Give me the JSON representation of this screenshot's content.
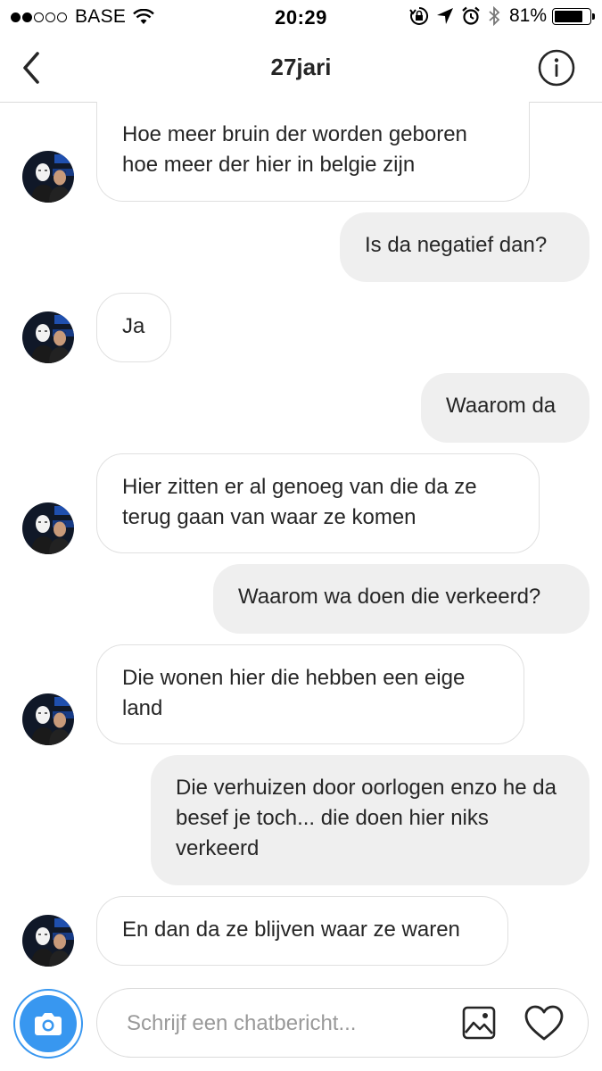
{
  "status_bar": {
    "carrier": "BASE",
    "time": "20:29",
    "battery_percent": "81%",
    "battery_level": 0.81,
    "signal_bars_filled": 2,
    "signal_bars_total": 5,
    "icons": [
      "wifi-icon",
      "rotation-lock-icon",
      "location-arrow-icon",
      "alarm-icon",
      "bluetooth-icon",
      "battery-icon"
    ]
  },
  "nav": {
    "title": "27jari",
    "back_icon": "chevron-left-icon",
    "info_icon": "info-icon"
  },
  "messages": [
    {
      "direction": "in",
      "text": "Hoe meer bruin der worden geboren hoe meer der hier in belgie zijn"
    },
    {
      "direction": "out",
      "text": "Is da negatief dan?"
    },
    {
      "direction": "in",
      "text": "Ja"
    },
    {
      "direction": "out",
      "text": "Waarom da"
    },
    {
      "direction": "in",
      "text": "Hier zitten er al genoeg van die da ze terug gaan van waar ze komen"
    },
    {
      "direction": "out",
      "text": "Waarom wa doen die verkeerd?"
    },
    {
      "direction": "in",
      "text": "Die wonen hier die hebben een eige land"
    },
    {
      "direction": "out",
      "text": "Die verhuizen door oorlogen enzo he da besef je toch... die doen hier niks verkeerd"
    },
    {
      "direction": "in",
      "text": "En dan da ze blijven waar ze waren"
    }
  ],
  "composer": {
    "placeholder": "Schrijf een chatbericht...",
    "camera_icon": "camera-icon",
    "gallery_icon": "gallery-icon",
    "heart_icon": "heart-icon",
    "accent_color": "#3897f0"
  }
}
